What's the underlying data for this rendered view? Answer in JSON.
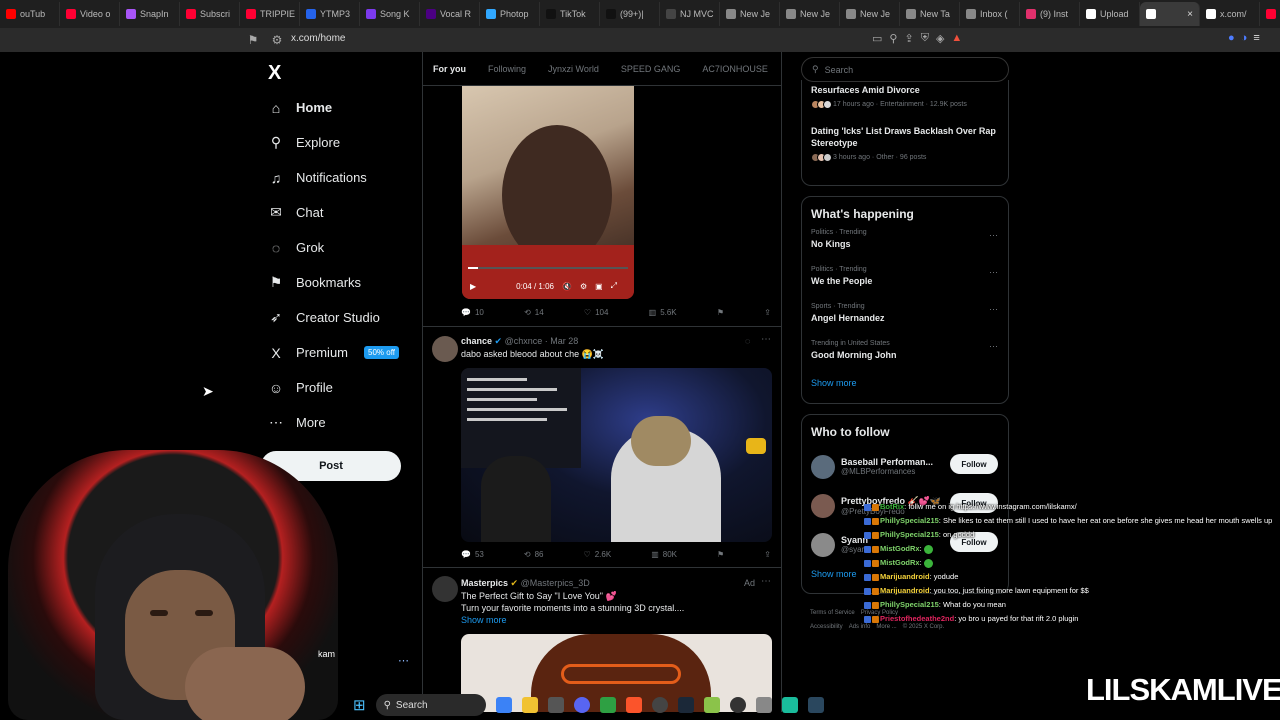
{
  "browser": {
    "tabs": [
      {
        "label": "ouTub",
        "color": "#ff0000"
      },
      {
        "label": "Video o",
        "color": "#ff0033"
      },
      {
        "label": "SnapIn",
        "color": "#a855f7"
      },
      {
        "label": "Subscri",
        "color": "#ff0033"
      },
      {
        "label": "TRIPPIE",
        "color": "#ff0033"
      },
      {
        "label": "YTMP3",
        "color": "#2563eb"
      },
      {
        "label": "Song K",
        "color": "#7c3aed"
      },
      {
        "label": "Vocal R",
        "color": "#4b0082"
      },
      {
        "label": "Photop",
        "color": "#31a8ff"
      },
      {
        "label": "TikTok",
        "color": "#111111"
      },
      {
        "label": "(99+)|",
        "color": "#111111"
      },
      {
        "label": "NJ MVC",
        "color": "#444444"
      },
      {
        "label": "New Je",
        "color": "#888888"
      },
      {
        "label": "New Je",
        "color": "#888888"
      },
      {
        "label": "New Je",
        "color": "#888888"
      },
      {
        "label": "New Ta",
        "color": "#888888"
      },
      {
        "label": "Inbox (",
        "color": "#888888"
      },
      {
        "label": "(9) Inst",
        "color": "#e1306c"
      },
      {
        "label": "Upload",
        "color": "#ffffff"
      },
      {
        "label": "",
        "color": "#ffffff",
        "active": true
      },
      {
        "label": "x.com/",
        "color": "#ffffff"
      },
      {
        "label": "YNW",
        "color": "#ff0033"
      }
    ],
    "url": "x.com/home"
  },
  "nav": {
    "logo": "X",
    "items": [
      {
        "label": "Home",
        "icon": "home-icon",
        "glyph": "⌂"
      },
      {
        "label": "Explore",
        "icon": "search-icon",
        "glyph": "⚲"
      },
      {
        "label": "Notifications",
        "icon": "bell-icon",
        "glyph": "♫"
      },
      {
        "label": "Chat",
        "icon": "mail-icon",
        "glyph": "✉"
      },
      {
        "label": "Grok",
        "icon": "grok-icon",
        "glyph": "◌"
      },
      {
        "label": "Bookmarks",
        "icon": "bookmark-icon",
        "glyph": "⚑"
      },
      {
        "label": "Creator Studio",
        "icon": "rocket-icon",
        "glyph": "➶"
      },
      {
        "label": "Premium",
        "icon": "x-icon",
        "glyph": "X"
      },
      {
        "label": "Profile",
        "icon": "person-icon",
        "glyph": "☺"
      },
      {
        "label": "More",
        "icon": "more-icon",
        "glyph": "⋯"
      }
    ],
    "premium_badge": "50% off",
    "post_button": "Post"
  },
  "webcam": {
    "username": "kam"
  },
  "feed": {
    "tabs": [
      "For you",
      "Following",
      "Jynxzi World",
      "SPEED GANG",
      "AC7IONHOUSE",
      "B"
    ],
    "video_post": {
      "time": "0:04 / 1:06",
      "replies": "10",
      "reposts": "14",
      "likes": "104",
      "views": "5.6K"
    },
    "post2": {
      "name": "chance",
      "handle": "@chxnce",
      "date": "Mar 28",
      "text": "dabo asked bleood about che 😭☠️",
      "replies": "53",
      "reposts": "86",
      "likes": "2.6K",
      "views": "80K"
    },
    "post3": {
      "name": "Masterpics",
      "handle": "@Masterpics_3D",
      "ad": "Ad",
      "text1": "The Perfect Gift to Say \"I Love You\" 💕",
      "text2": "Turn your favorite moments into a stunning 3D crystal....",
      "show_more": "Show more"
    }
  },
  "sidebar": {
    "search_placeholder": "Search",
    "news": [
      {
        "headline": "Resurfaces Amid Divorce",
        "meta": "17 hours ago · Entertainment · 12.9K posts"
      },
      {
        "headline": "Dating 'Icks' List Draws Backlash Over Rap Stereotype",
        "meta": "3 hours ago · Other · 96 posts"
      }
    ],
    "whats_happening": {
      "title": "What's happening",
      "trends": [
        {
          "meta": "Politics · Trending",
          "name": "No Kings"
        },
        {
          "meta": "Politics · Trending",
          "name": "We the People"
        },
        {
          "meta": "Sports · Trending",
          "name": "Angel Hernandez"
        },
        {
          "meta": "Trending in United States",
          "name": "Good Morning John"
        }
      ],
      "show_more": "Show more"
    },
    "who_to_follow": {
      "title": "Who to follow",
      "accounts": [
        {
          "name": "Baseball Performan...",
          "handle": "@MLBPerformances",
          "color": "#5a6b7c"
        },
        {
          "name": "Prettyboyfredo 🎸💕🦋",
          "handle": "@PrettyBoyFredo",
          "color": "#7a5a50"
        },
        {
          "name": "Syann",
          "handle": "@syan",
          "color": "#8a8a8a"
        }
      ],
      "follow_label": "Follow",
      "show_more": "Show more"
    },
    "footer": [
      "Terms of Service",
      "Privacy Policy",
      "Accessibility",
      "Ads info",
      "More ...",
      "© 2025 X Corp."
    ]
  },
  "chat": [
    {
      "user": "BotRix",
      "color": "#3bb33b",
      "msg": ": follw me on ig https://www.instagram.com/lilskamx/"
    },
    {
      "user": "PhillySpecial215",
      "color": "#7fd36b",
      "msg": ": She likes to eat them still I used to have her eat one before she gives me head her mouth swells up"
    },
    {
      "user": "PhillySpecial215",
      "color": "#7fd36b",
      "msg": ": on goddd"
    },
    {
      "user": "MistGodRx",
      "color": "#7fd36b",
      "msg": ": "
    },
    {
      "user": "MistGodRx",
      "color": "#7fd36b",
      "msg": ": "
    },
    {
      "user": "Marijuandroid",
      "color": "#f5d33b",
      "msg": ": yodude"
    },
    {
      "user": "Marijuandroid",
      "color": "#f5d33b",
      "msg": ": you too, just fixing more lawn equipment for $$"
    },
    {
      "user": "PhillySpecial215",
      "color": "#7fd36b",
      "msg": ": What do you mean"
    },
    {
      "user": "Priestofhedeathe2nd",
      "color": "#e0245e",
      "msg": ": yo bro u payed for that rift 2.0 plugin"
    }
  ],
  "watermark": "LILSKAMLIVE",
  "taskbar": {
    "search": "Search"
  }
}
